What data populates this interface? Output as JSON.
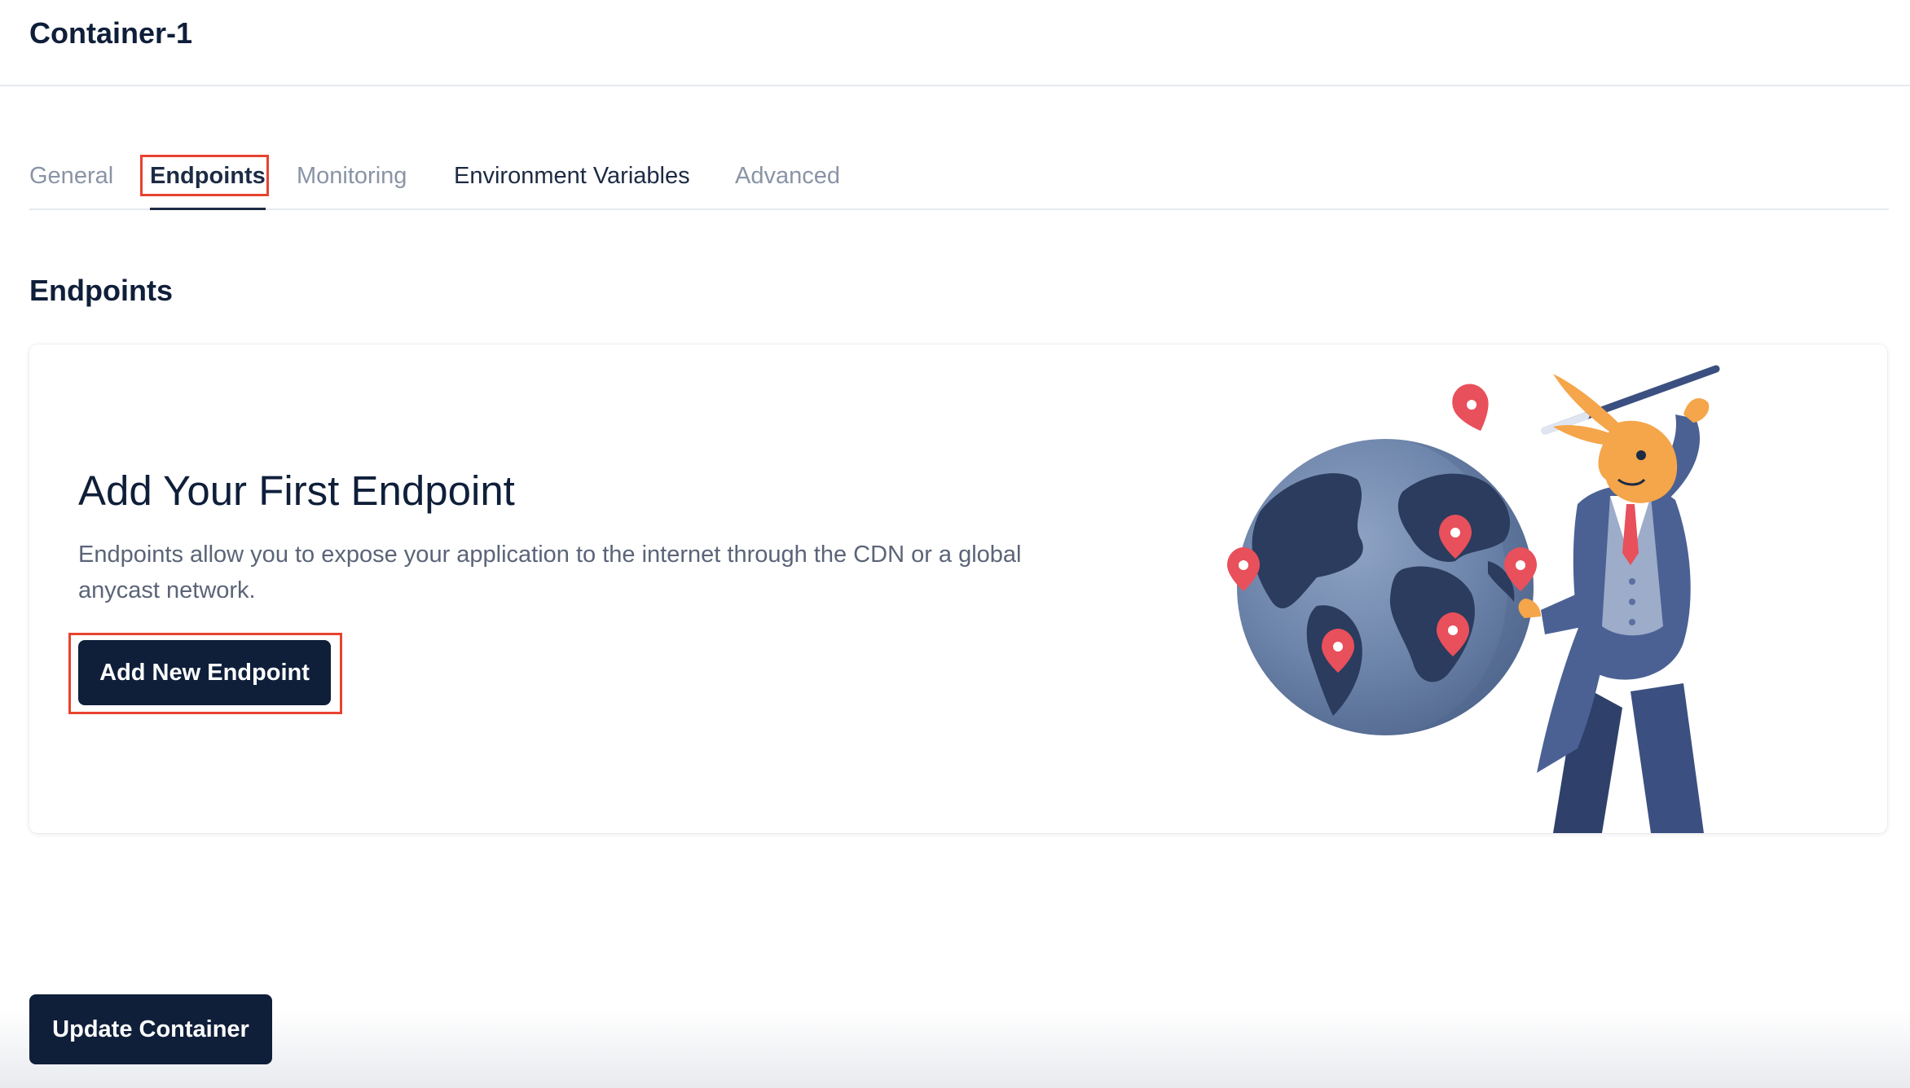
{
  "header": {
    "title": "Container-1"
  },
  "tabs": [
    {
      "label": "General",
      "state": "inactive"
    },
    {
      "label": "Endpoints",
      "state": "active"
    },
    {
      "label": "Monitoring",
      "state": "inactive"
    },
    {
      "label": "Environment Variables",
      "state": "inactive"
    },
    {
      "label": "Advanced",
      "state": "inactive"
    }
  ],
  "section": {
    "title": "Endpoints"
  },
  "empty_state": {
    "heading": "Add Your First Endpoint",
    "description": "Endpoints allow you to expose your application to the internet through the CDN or a global anycast network.",
    "button_label": "Add New Endpoint",
    "illustration": "rabbit-mascot-with-globe-and-map-pins"
  },
  "footer": {
    "update_button_label": "Update Container"
  },
  "colors": {
    "primary": "#0f1f3a",
    "annotation": "#e8432f",
    "muted_text": "#8a94a6",
    "pin": "#e8505b",
    "mascot": "#f5a54a"
  }
}
